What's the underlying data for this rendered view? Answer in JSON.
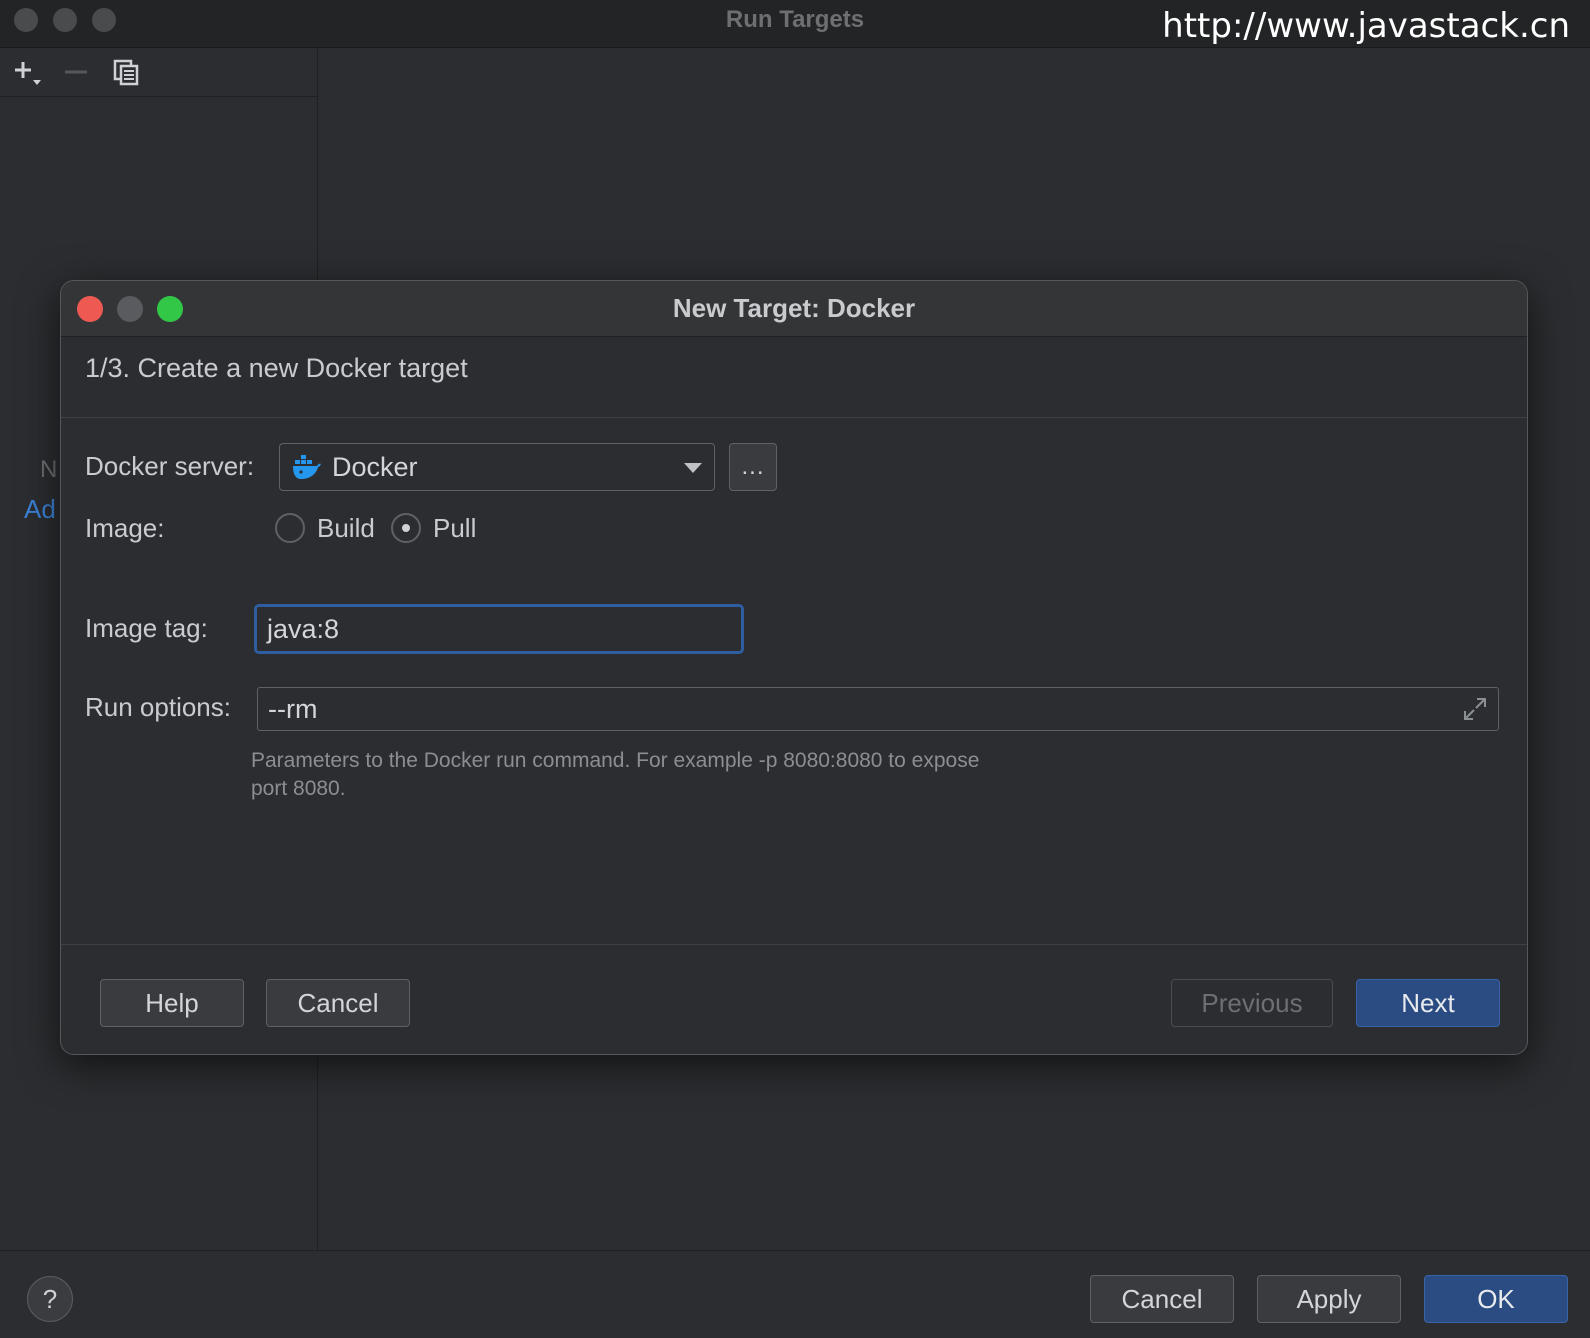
{
  "window": {
    "title": "Run Targets"
  },
  "watermark": "http://www.javastack.cn",
  "left_panel": {
    "hint_line1": "N",
    "hint_line2": "Ad",
    "toolbar": {
      "add_icon": "+",
      "remove_icon": "−"
    }
  },
  "dialog": {
    "title": "New Target: Docker",
    "step": "1/3. Create a new Docker target",
    "docker_server": {
      "label": "Docker server:",
      "value": "Docker",
      "browse_label": "..."
    },
    "image": {
      "label": "Image:",
      "options": [
        "Build",
        "Pull"
      ],
      "selected": "Pull"
    },
    "image_tag": {
      "label": "Image tag:",
      "value": "java:8"
    },
    "run_options": {
      "label": "Run options:",
      "value": "--rm",
      "help": "Parameters to the Docker run command. For example -p 8080:8080 to expose port 8080."
    },
    "buttons": {
      "help": "Help",
      "cancel": "Cancel",
      "previous": "Previous",
      "next": "Next"
    }
  },
  "footer": {
    "help_icon": "?",
    "buttons": {
      "cancel": "Cancel",
      "apply": "Apply",
      "ok": "OK"
    }
  },
  "colors": {
    "background": "#2b2d30",
    "primary_button": "#2a4c82",
    "focus_ring": "#2f5ea0",
    "link": "#3b82d6",
    "traffic_red": "#ee5a52",
    "traffic_green": "#33c748"
  }
}
